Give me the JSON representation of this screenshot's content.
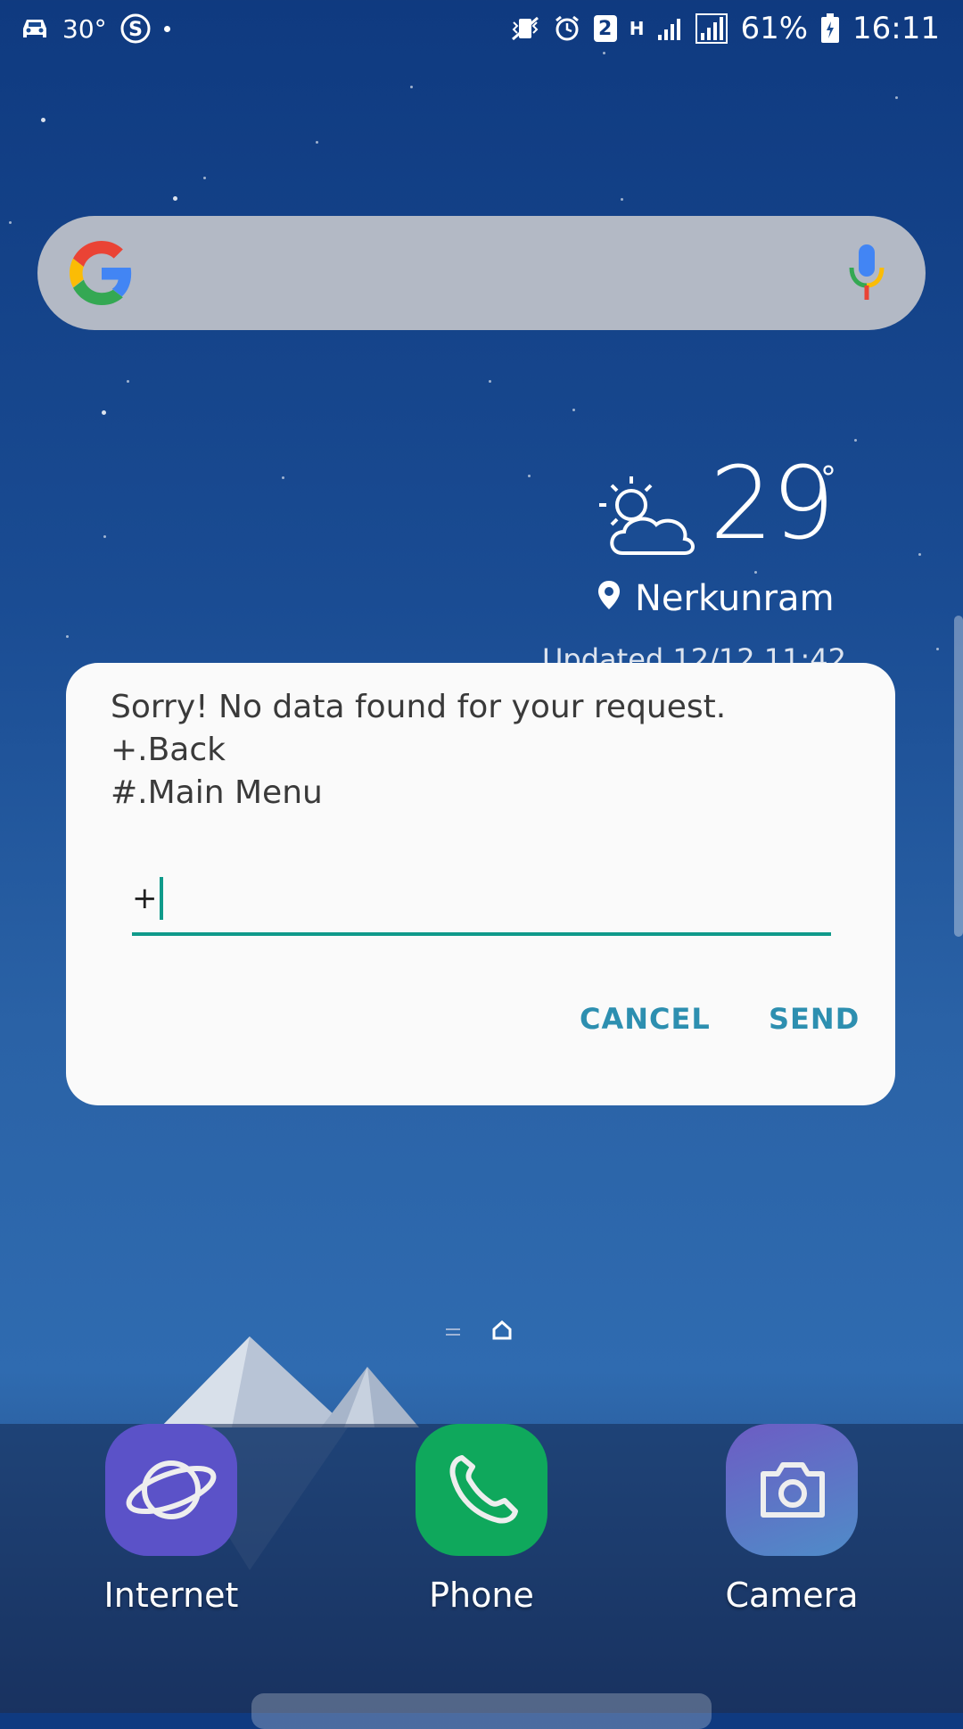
{
  "status_bar": {
    "left_temp": "30°",
    "notification_count": "2",
    "network_type": "H",
    "battery_percent": "61%",
    "time": "16:11",
    "icons_left": [
      "car-icon",
      "skype-icon",
      "dot-icon"
    ],
    "icons_right": [
      "vibrate-mute-icon",
      "alarm-icon",
      "network-h-icon",
      "signal-icon",
      "roaming-signal-icon",
      "battery-icon"
    ]
  },
  "search_bar": {
    "logo": "google-logo-icon",
    "mic": "microphone-icon"
  },
  "weather": {
    "temperature": "29",
    "degree_symbol": "°",
    "location": "Nerkunram",
    "updated": "Updated 12/12 11:42"
  },
  "dialog": {
    "lines": [
      "Sorry! No data found for your request.",
      "+.Back",
      "#.Main Menu"
    ],
    "input_value": "+",
    "cancel_label": "CANCEL",
    "send_label": "SEND",
    "accent_color": "#0f9a8a",
    "button_color": "#2d8fb0"
  },
  "dock": {
    "apps": [
      {
        "label": "Internet",
        "icon": "internet-planet-icon",
        "color": "#5b52c8"
      },
      {
        "label": "Phone",
        "icon": "phone-icon",
        "color": "#0fa85c"
      },
      {
        "label": "Camera",
        "icon": "camera-icon",
        "color": "#6a5ec0"
      }
    ]
  }
}
